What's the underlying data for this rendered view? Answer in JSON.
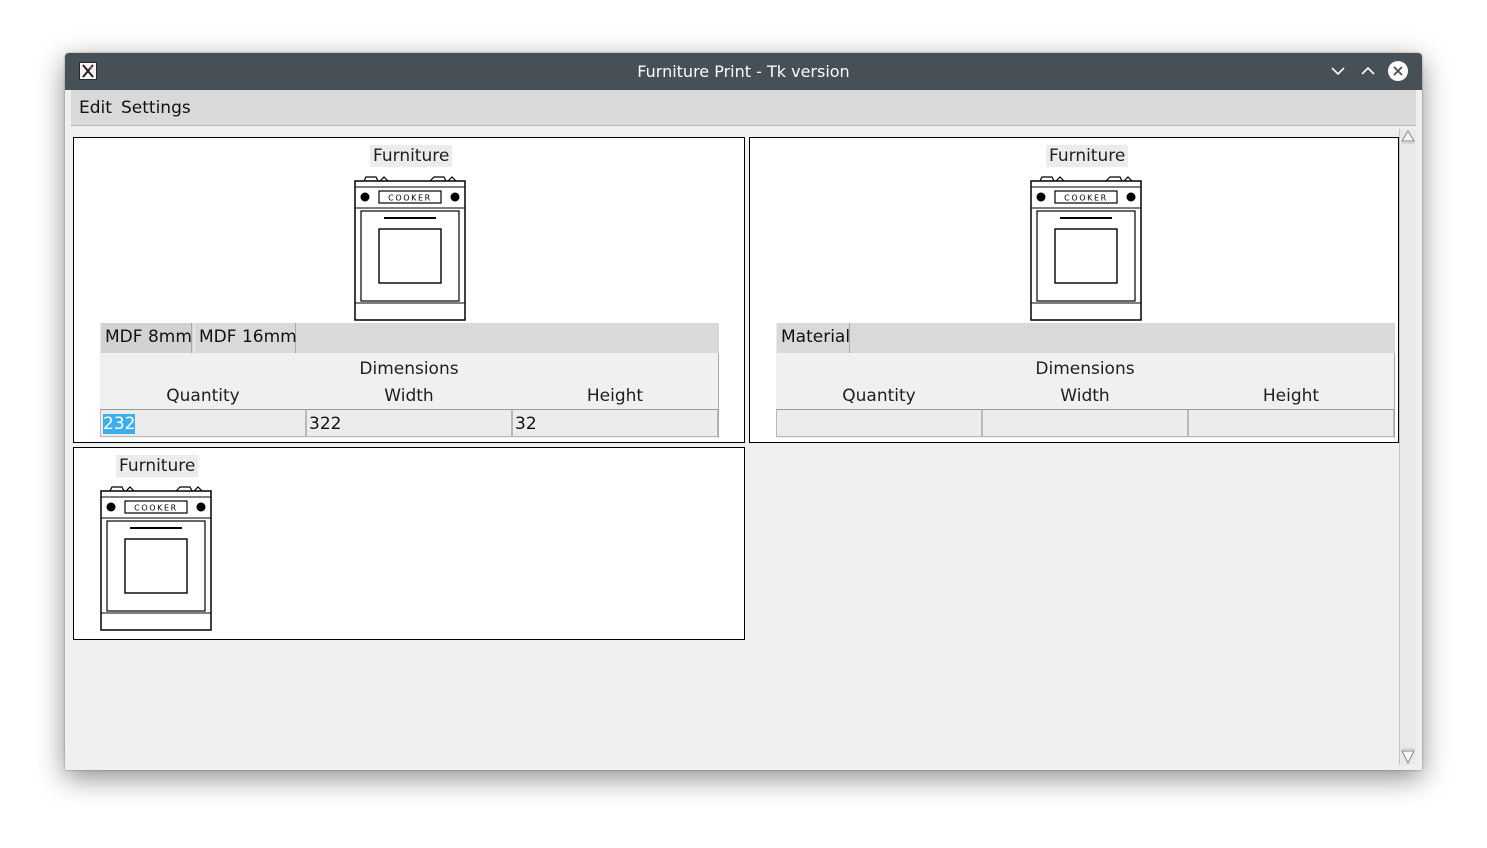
{
  "window": {
    "title": "Furniture Print - Tk version"
  },
  "menu": {
    "edit": "Edit",
    "settings": "Settings"
  },
  "panels": [
    {
      "label": "Furniture",
      "cooker_text": "COOKER",
      "tabs": [
        "MDF 8mm",
        "MDF 16mm"
      ],
      "dimensions_title": "Dimensions",
      "columns": [
        "Quantity",
        "Width",
        "Height"
      ],
      "values": {
        "quantity": "232",
        "width": "322",
        "height": "32"
      }
    },
    {
      "label": "Furniture",
      "cooker_text": "COOKER",
      "tabs": [
        "Material"
      ],
      "dimensions_title": "Dimensions",
      "columns": [
        "Quantity",
        "Width",
        "Height"
      ],
      "values": {
        "quantity": "",
        "width": "",
        "height": ""
      }
    },
    {
      "label": "Furniture",
      "cooker_text": "COOKER"
    }
  ],
  "icons": [
    "app-icon",
    "minimize-icon",
    "maximize-icon",
    "close-icon",
    "cooker-image"
  ],
  "colors": {
    "titlebar": "#475057",
    "selection": "#3daee9",
    "window_bg": "#eff0f1"
  }
}
